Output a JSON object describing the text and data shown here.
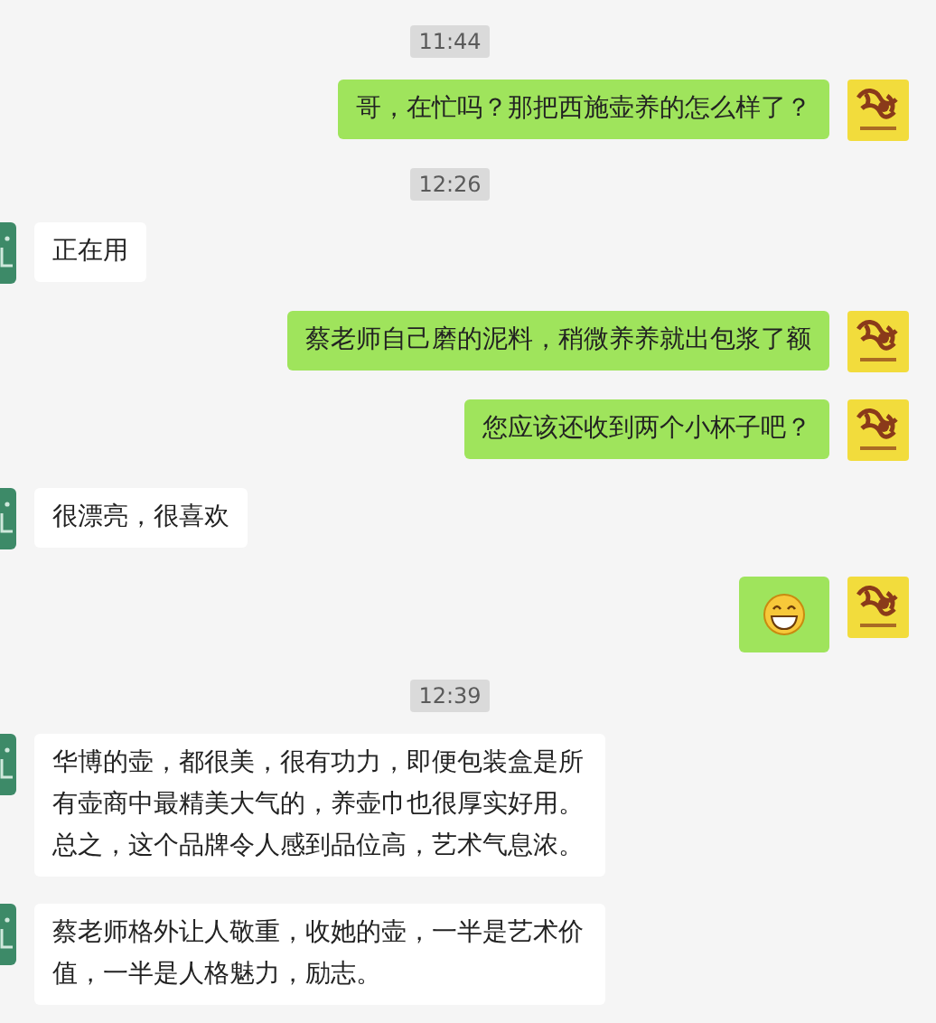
{
  "messages": [
    {
      "kind": "time",
      "text": "11:44"
    },
    {
      "kind": "sent",
      "text": "哥，在忙吗？那把西施壶养的怎么样了？"
    },
    {
      "kind": "time",
      "text": "12:26"
    },
    {
      "kind": "received",
      "text": "正在用"
    },
    {
      "kind": "sent",
      "text": "蔡老师自己磨的泥料，稍微养养就出包浆了额"
    },
    {
      "kind": "sent",
      "text": "您应该还收到两个小杯子吧？"
    },
    {
      "kind": "received",
      "text": "很漂亮，很喜欢"
    },
    {
      "kind": "sent_emoji"
    },
    {
      "kind": "time",
      "text": "12:39"
    },
    {
      "kind": "received",
      "text": "华博的壶，都很美，很有功力，即便包装盒是所有壶商中最精美大气的，养壶巾也很厚实好用。总之，这个品牌令人感到品位高，艺术气息浓。"
    },
    {
      "kind": "received",
      "text": "蔡老师格外让人敬重，收她的壶，一半是艺术价值，一半是人格魅力，励志。"
    }
  ]
}
